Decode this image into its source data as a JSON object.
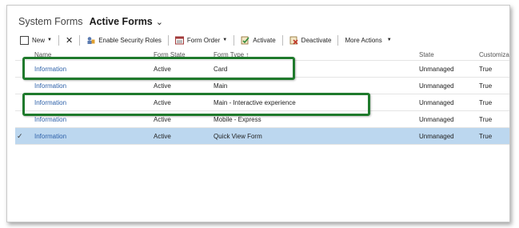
{
  "window": {
    "title_prefix": "System Forms",
    "title_main": "Active Forms",
    "title_chevron": "⌄"
  },
  "toolbar": {
    "new_label": "New",
    "enable_security_roles_label": "Enable Security Roles",
    "form_order_label": "Form Order",
    "activate_label": "Activate",
    "deactivate_label": "Deactivate",
    "more_actions_label": "More Actions",
    "delete_glyph": "✕",
    "caret": "▼"
  },
  "grid": {
    "columns": {
      "name": "Name",
      "form_state": "Form State",
      "form_type": "Form Type ↑",
      "state": "State",
      "customizable": "Customiza"
    },
    "rows": [
      {
        "check": "",
        "name": "Information",
        "form_state": "Active",
        "form_type": "Card",
        "state": "Unmanaged",
        "customizable": "True"
      },
      {
        "check": "",
        "name": "Information",
        "form_state": "Active",
        "form_type": "Main",
        "state": "Unmanaged",
        "customizable": "True"
      },
      {
        "check": "",
        "name": "Information",
        "form_state": "Active",
        "form_type": "Main - Interactive experience",
        "state": "Unmanaged",
        "customizable": "True"
      },
      {
        "check": "",
        "name": "Information",
        "form_state": "Active",
        "form_type": "Mobile - Express",
        "state": "Unmanaged",
        "customizable": "True"
      },
      {
        "check": "✓",
        "name": "Information",
        "form_state": "Active",
        "form_type": "Quick View Form",
        "state": "Unmanaged",
        "customizable": "True"
      }
    ]
  },
  "colors": {
    "link": "#2b5fa8",
    "selected_row": "#bcd7ef",
    "highlight_box": "#1f7a2c"
  }
}
